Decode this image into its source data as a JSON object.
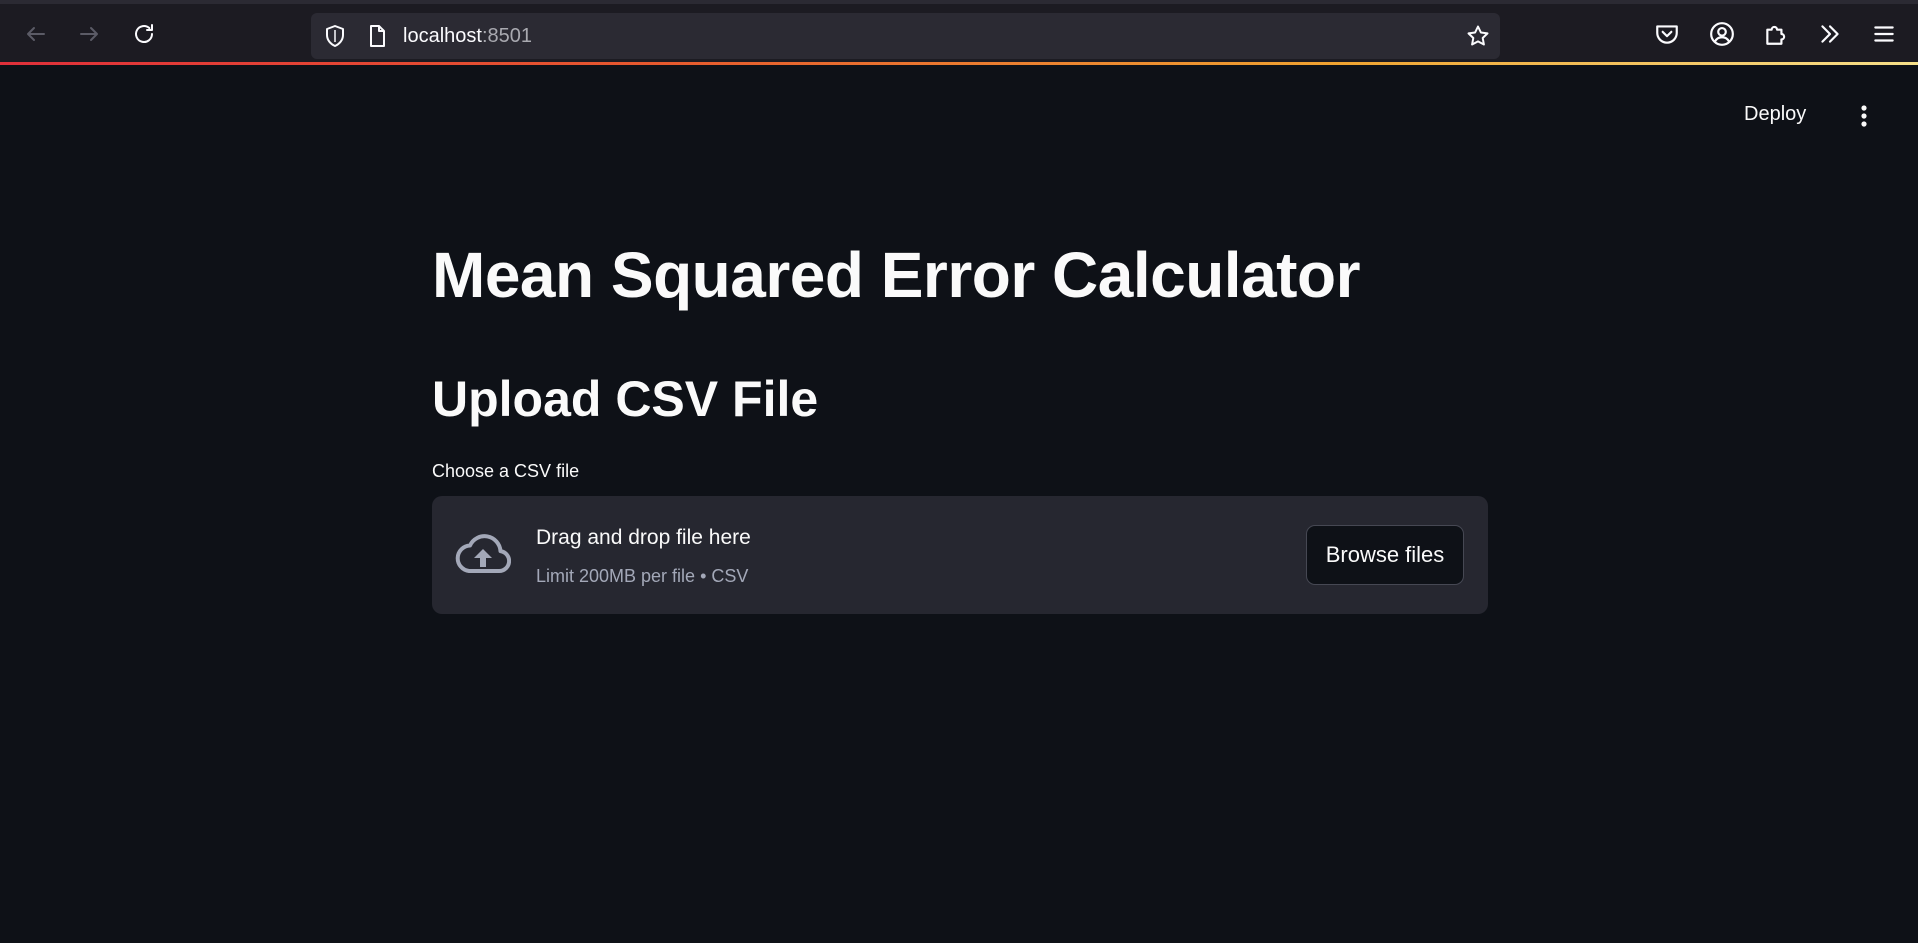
{
  "browser": {
    "url_host": "localhost",
    "url_port": ":8501"
  },
  "header": {
    "deploy_label": "Deploy"
  },
  "main": {
    "title": "Mean Squared Error Calculator",
    "subheader": "Upload CSV File",
    "uploader": {
      "label": "Choose a CSV file",
      "drop_text": "Drag and drop file here",
      "limit_text": "Limit 200MB per file • CSV",
      "browse_label": "Browse files"
    }
  },
  "colors": {
    "background": "#0e1117",
    "dropzone": "#262730",
    "browser_chrome": "#1c1b22"
  }
}
